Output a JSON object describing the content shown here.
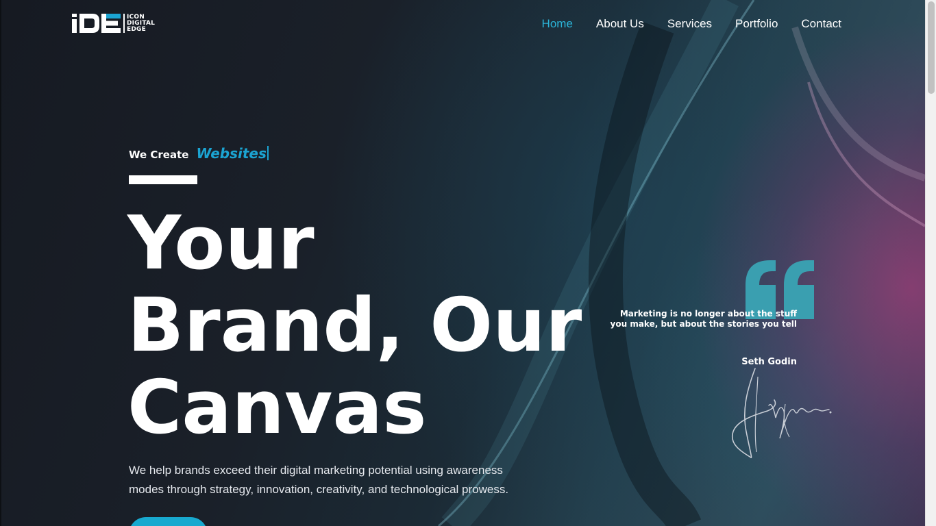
{
  "brand": {
    "logo_mark": "IDE",
    "logo_lines": [
      "ICON",
      "DIGITAL",
      "EDGE"
    ]
  },
  "nav": {
    "items": [
      {
        "label": "Home",
        "active": true
      },
      {
        "label": "About Us",
        "active": false
      },
      {
        "label": "Services",
        "active": false
      },
      {
        "label": "Portfolio",
        "active": false
      },
      {
        "label": "Contact",
        "active": false
      }
    ]
  },
  "hero": {
    "kicker_static": "We Create",
    "kicker_dynamic": "Websites",
    "headline_lines": [
      "Your",
      "Brand, Our",
      "Canvas"
    ],
    "intro": "We help brands exceed their digital marketing potential using awareness modes through strategy, innovation, creativity, and technological prowess."
  },
  "quote": {
    "text": "Marketing is no longer about the stuff you make, but about the stories you tell",
    "author": "Seth Godin",
    "icon": "quote-icon"
  },
  "colors": {
    "accent": "#1ba4d2",
    "nav_active": "#2bb5d9",
    "quote_mark": "#3a9fb0"
  }
}
